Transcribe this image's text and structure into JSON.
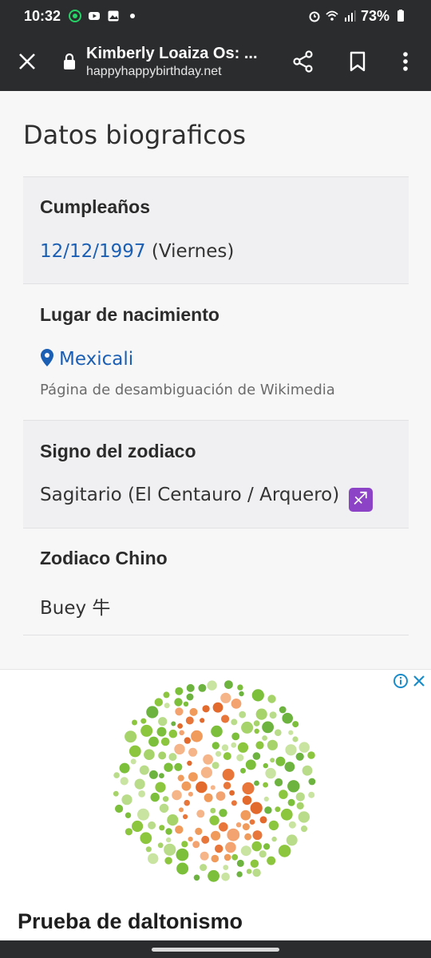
{
  "status_bar": {
    "time": "10:32",
    "battery": "73%",
    "left_icons": [
      "whatsapp-icon",
      "youtube-icon",
      "gallery-icon",
      "dot-icon"
    ],
    "right_icons": [
      "alarm-icon",
      "wifi-icon",
      "signal-icon",
      "battery-icon"
    ]
  },
  "browser": {
    "page_title": "Kimberly Loaiza Os: ...",
    "host": "happyhappybirthday.net",
    "icons": [
      "close-icon",
      "lock-icon",
      "share-icon",
      "bookmark-icon",
      "more-vert-icon"
    ]
  },
  "biography": {
    "heading": "Datos biograficos",
    "birthday": {
      "label": "Cumpleaños",
      "date": "12/12/1997",
      "weekday": "(Viernes)"
    },
    "birthplace": {
      "label": "Lugar de nacimiento",
      "place": "Mexicali",
      "note": "Página de desambiguación de Wikimedia"
    },
    "zodiac": {
      "label": "Signo del zodiaco",
      "value": "Sagitario (El Centauro / Arquero)",
      "symbol": "♐"
    },
    "chinese_zodiac": {
      "label": "Zodiaco Chino",
      "value": "Buey 牛"
    }
  },
  "ad": {
    "headline": "Prueba de daltonismo",
    "controls": [
      "ad-info-icon",
      "ad-close-icon"
    ]
  },
  "colors": {
    "bars": "#2b2c2e",
    "link": "#1a5fb4",
    "zodiac_badge": "#8d43c6"
  }
}
